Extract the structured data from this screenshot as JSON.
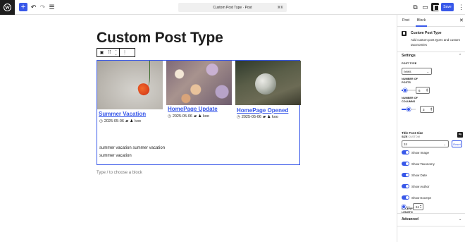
{
  "topbar": {
    "command_bar_text": "Custom Post Type · Post",
    "command_shortcut": "⌘K",
    "save_label": "Save"
  },
  "editor": {
    "post_title": "Custom Post Type",
    "appender_placeholder": "Type / to choose a block",
    "posts": [
      {
        "title": "Summer Vacation",
        "date": "2025-05-06",
        "author": "koo",
        "excerpt": "summer vacation summer vacation summer vacation"
      },
      {
        "title": "HomePage Update",
        "date": "2025-05-06",
        "author": "koo"
      },
      {
        "title": "HomePage Opened",
        "date": "2025-05-06",
        "author": "koo"
      }
    ]
  },
  "sidebar": {
    "tabs": [
      "Post",
      "Block"
    ],
    "active_tab": "Block",
    "block_name": "Custom Post Type",
    "block_description": "Add custom post types and custom taxonomies",
    "settings_title": "Settings",
    "post_type_label": "POST TYPE",
    "post_type_value": "news",
    "number_of_posts_label": "NUMBER OF POSTS",
    "number_of_posts_value": "6",
    "number_of_posts_fill": 0.25,
    "number_of_columns_label": "NUMBER OF COLUMNS",
    "number_of_columns_value": "3",
    "number_of_columns_fill": 0.5,
    "title_font_size_label": "Title Font Size",
    "size_label": "SIZE",
    "size_mode": "CUSTOM",
    "font_size_value": "24",
    "reset_label": "Reset",
    "toggles": [
      {
        "label": "Show Image",
        "on": true
      },
      {
        "label": "Show Taxonomy",
        "on": true
      },
      {
        "label": "Show Date",
        "on": true
      },
      {
        "label": "Show Author",
        "on": true
      },
      {
        "label": "Show Excerpt",
        "on": true
      }
    ],
    "excerpt_length_label": "EXCERPT LENGTH",
    "excerpt_length_value": "61",
    "excerpt_length_fill": 0.1,
    "advanced_label": "Advanced"
  },
  "colors": {
    "accent": "#3858e9",
    "dark": "#1e1e1e"
  }
}
